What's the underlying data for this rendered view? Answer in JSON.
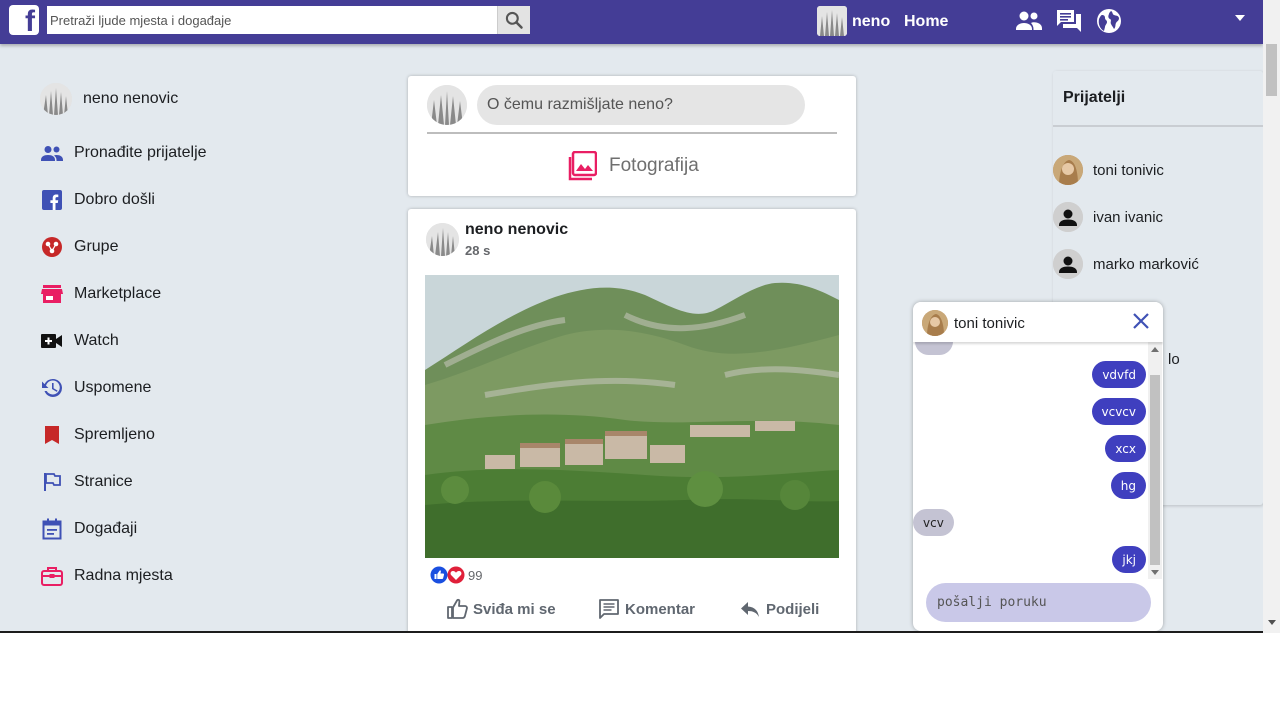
{
  "colors": {
    "topbar": "#443d96",
    "accent": "#3f3fbf",
    "background": "#e3e9ee",
    "pink": "#e91e63"
  },
  "header": {
    "logo": "f",
    "search_placeholder": "Pretraži ljude mjesta i događaje",
    "search_icon": "search-icon",
    "user_name": "neno",
    "home_label": "Home",
    "icons": [
      "friends-icon",
      "messages-icon",
      "globe-icon",
      "dropdown-caret-icon"
    ]
  },
  "sidebar": {
    "profile_name": "neno  nenovic",
    "items": [
      {
        "label": "Pronađite prijatelje",
        "icon": "friends-icon"
      },
      {
        "label": "Dobro došli",
        "icon": "facebook-icon"
      },
      {
        "label": "Grupe",
        "icon": "groups-icon"
      },
      {
        "label": "Marketplace",
        "icon": "store-icon"
      },
      {
        "label": "Watch",
        "icon": "video-icon"
      },
      {
        "label": "Uspomene",
        "icon": "history-icon"
      },
      {
        "label": "Spremljeno",
        "icon": "bookmark-icon"
      },
      {
        "label": "Stranice",
        "icon": "flag-icon"
      },
      {
        "label": "Događaji",
        "icon": "calendar-icon"
      },
      {
        "label": "Radna mjesta",
        "icon": "briefcase-icon"
      }
    ]
  },
  "composer": {
    "placeholder": "O čemu razmišljate neno?",
    "photo_label": "Fotografija"
  },
  "post": {
    "author": "neno nenovic",
    "time": "28 s",
    "reaction_count": "99",
    "actions": {
      "like": "Sviđa mi se",
      "comment": "Komentar",
      "share": "Podijeli"
    }
  },
  "friends": {
    "title": "Prijatelji",
    "items": [
      {
        "name": "toni  tonivic"
      },
      {
        "name": "ivan  ivanic"
      },
      {
        "name": "marko  marković"
      },
      {
        "name": "lo"
      }
    ]
  },
  "chat": {
    "name": "toni tonivic",
    "messages": [
      {
        "text": "vdvfd",
        "dir": "out"
      },
      {
        "text": "vcvcv",
        "dir": "out"
      },
      {
        "text": "xcx",
        "dir": "out"
      },
      {
        "text": "hg",
        "dir": "out"
      },
      {
        "text": "vcv",
        "dir": "in"
      },
      {
        "text": "jkj",
        "dir": "out"
      }
    ],
    "input_placeholder": "pošalji poruku"
  }
}
